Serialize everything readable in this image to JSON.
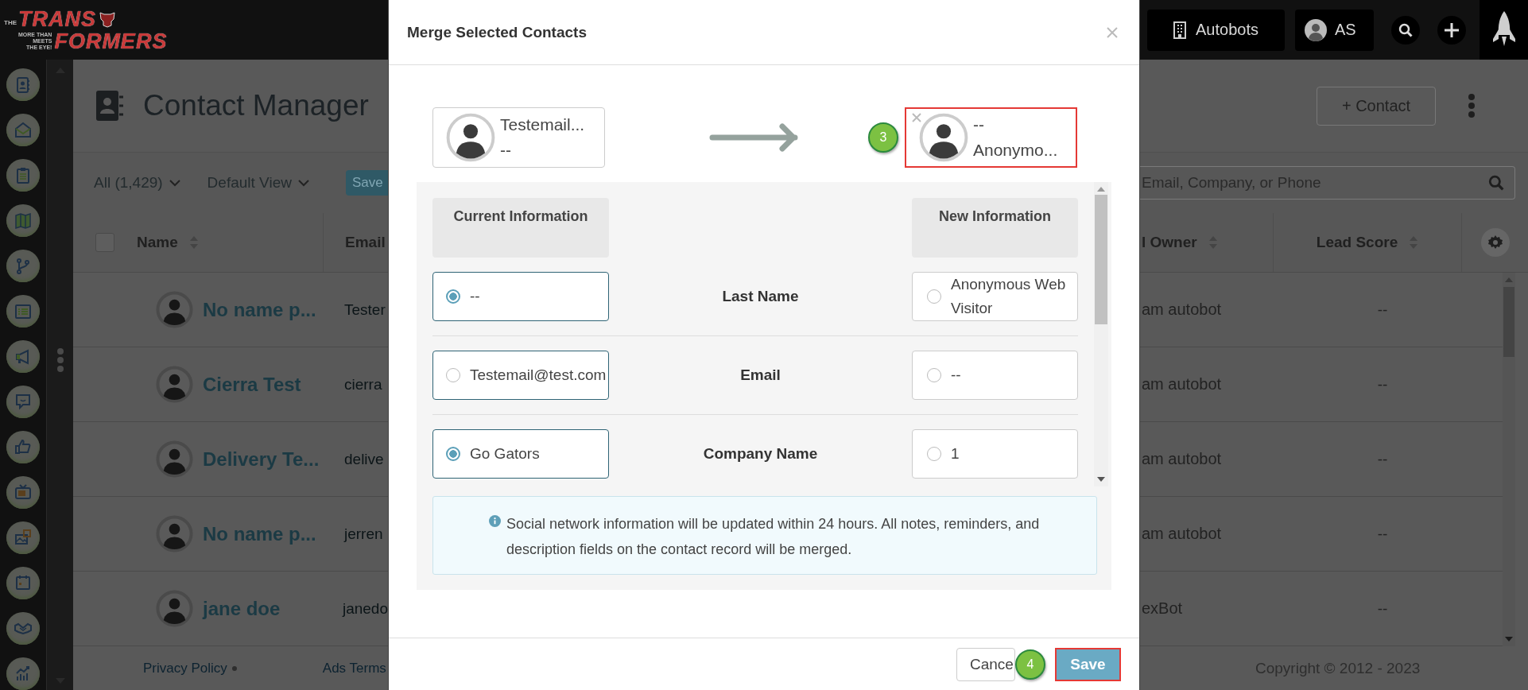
{
  "brand": {
    "small": "THE",
    "line1": "TRANS",
    "line2": "FORMERS",
    "tagline": [
      "MORE THAN",
      "MEETS",
      "THE EYE!"
    ]
  },
  "topbar": {
    "account": "Autobots",
    "user": "AS"
  },
  "page": {
    "title": "Contact Manager",
    "filter": "All (1,429)",
    "view": "Default View",
    "save_button": "Save",
    "add_button": "+ Contact",
    "search": {
      "placeholder": "Email, Company, or Phone"
    }
  },
  "table": {
    "select_all": {
      "checked": false
    },
    "columns": [
      "Name",
      "Email",
      "l Owner",
      "Lead Score"
    ],
    "rows": [
      {
        "name": "No name p...",
        "email": "Tester",
        "owner": "am autobot",
        "lead_score": "--"
      },
      {
        "name": "Cierra Test",
        "email": "cierra",
        "owner": "am autobot",
        "lead_score": "--"
      },
      {
        "name": "Delivery Te...",
        "email": "delive",
        "owner": "am autobot",
        "lead_score": "--"
      },
      {
        "name": "No name p...",
        "email": "jerren",
        "owner": "am autobot",
        "lead_score": "--"
      },
      {
        "name": "jane doe",
        "email": "janedo",
        "owner": "exBot",
        "lead_score": "--"
      }
    ]
  },
  "footer": {
    "links": [
      "Privacy Policy",
      "Ads Terms"
    ],
    "copyright": "Copyright © 2012 - 2023"
  },
  "modal": {
    "title": "Merge Selected Contacts",
    "source": {
      "name": "Testemail...",
      "detail": "--"
    },
    "target": {
      "name": "--",
      "detail": "Anonymo...",
      "highlighted": true,
      "callout": "3"
    },
    "columns": {
      "current": "Current Information",
      "new": "New Information"
    },
    "fields": [
      {
        "label": "Last Name",
        "current": {
          "value": "--",
          "selected": true
        },
        "new": {
          "value": "Anonymous Web Visitor",
          "selected": false
        }
      },
      {
        "label": "Email",
        "current": {
          "value": "Testemail@test.com",
          "selected": false
        },
        "new": {
          "value": "--",
          "selected": false
        }
      },
      {
        "label": "Company Name",
        "current": {
          "value": "Go Gators",
          "selected": true
        },
        "new": {
          "value": "1",
          "selected": false
        }
      }
    ],
    "note": "Social network information will be updated within 24 hours. All notes, reminders, and description fields on the contact record will be merged.",
    "buttons": [
      {
        "label": "Cance",
        "kind": "secondary",
        "highlighted": false
      },
      {
        "label": "Save",
        "kind": "primary",
        "highlighted": true,
        "callout": "4"
      }
    ]
  }
}
